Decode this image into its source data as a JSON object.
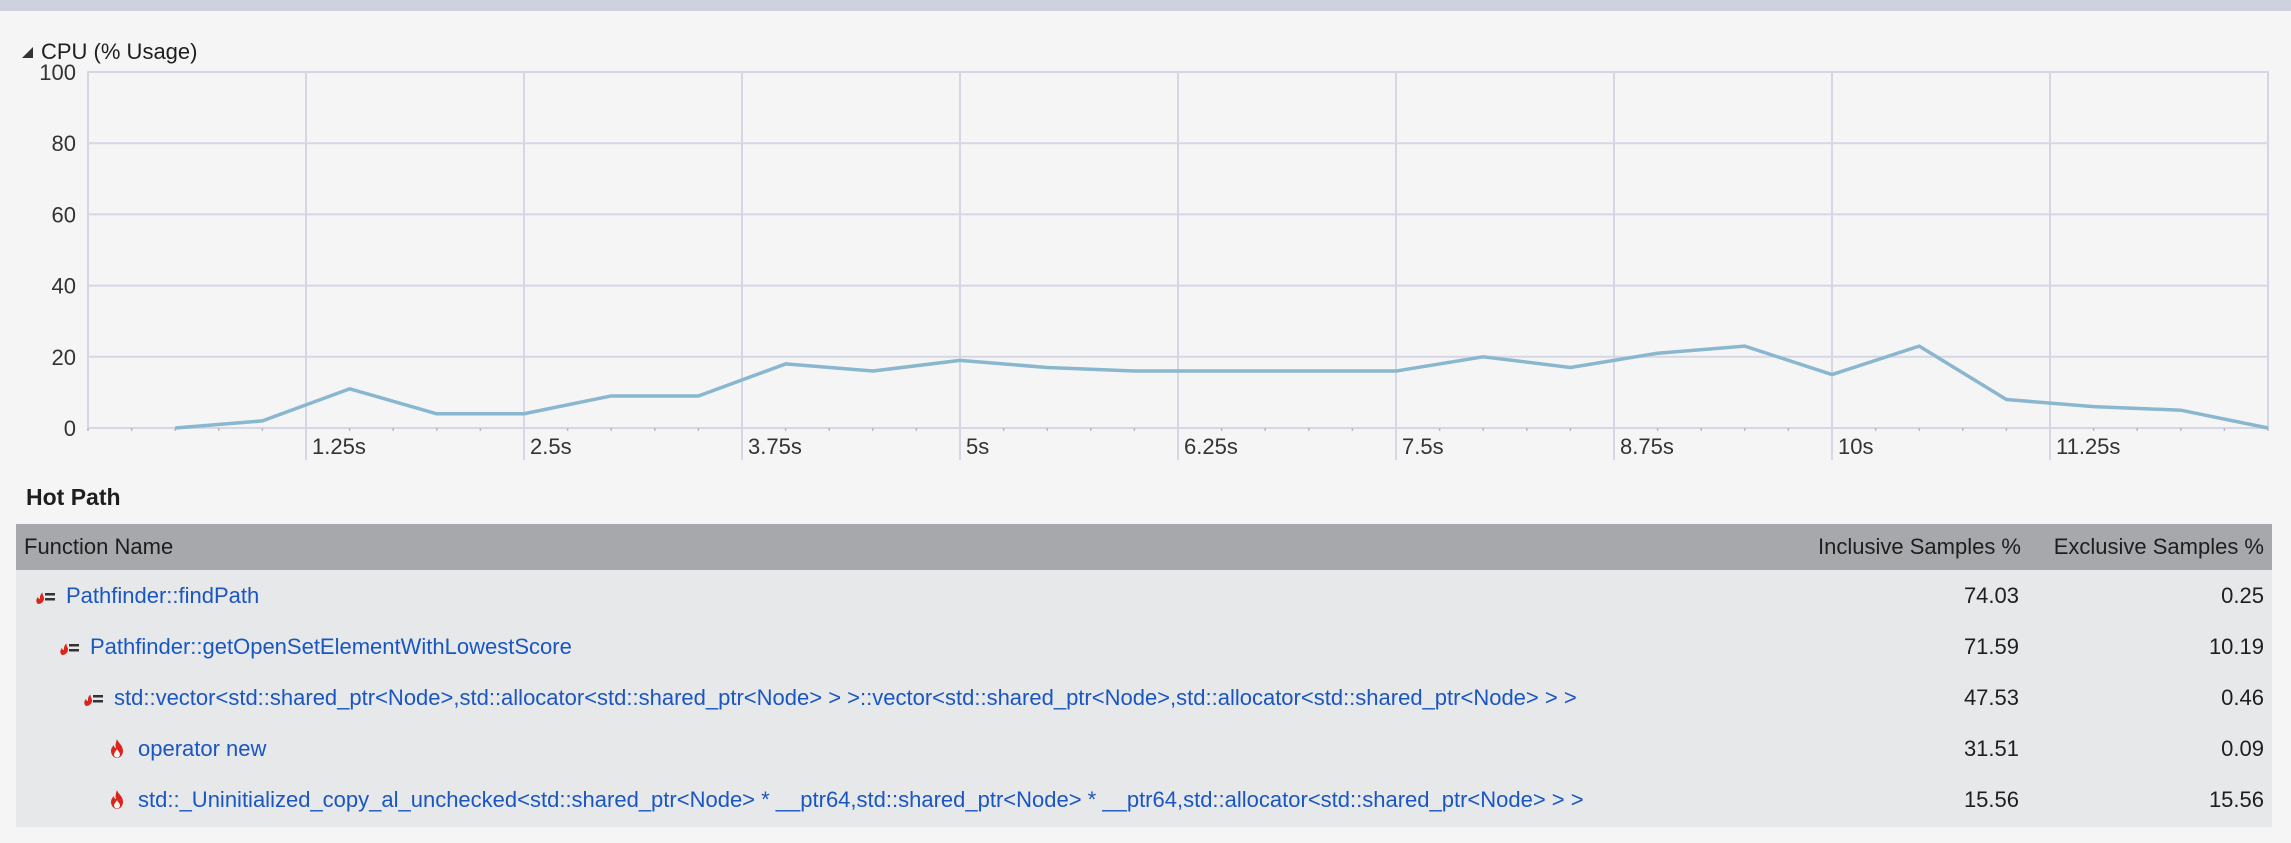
{
  "cpu_section": {
    "title": "CPU (% Usage)"
  },
  "chart_data": {
    "type": "line",
    "title": "CPU (% Usage)",
    "xlabel": "",
    "ylabel": "",
    "ylim": [
      0,
      100
    ],
    "xlim": [
      0,
      12.5
    ],
    "y_ticks": [
      "100",
      "80",
      "60",
      "40",
      "20",
      "0"
    ],
    "y_tick_values": [
      100,
      80,
      60,
      40,
      20,
      0
    ],
    "x_tick_labels": [
      "1.25s",
      "2.5s",
      "3.75s",
      "5s",
      "6.25s",
      "7.5s",
      "8.75s",
      "10s",
      "11.25s"
    ],
    "x_tick_values": [
      1.25,
      2.5,
      3.75,
      5,
      6.25,
      7.5,
      8.75,
      10,
      11.25
    ],
    "grid": true,
    "series": [
      {
        "color": "#8ab7d0",
        "x": [
          0.5,
          1.0,
          1.5,
          2.0,
          2.5,
          3.0,
          3.5,
          4.0,
          4.5,
          5.0,
          5.5,
          6.0,
          6.5,
          7.0,
          7.5,
          8.0,
          8.5,
          9.0,
          9.5,
          10.0,
          10.5,
          11.0,
          11.5,
          12.0,
          12.5
        ],
        "values": [
          0,
          2,
          11,
          4,
          4,
          9,
          9,
          18,
          16,
          19,
          17,
          16,
          16,
          16,
          16,
          20,
          17,
          21,
          23,
          15,
          23,
          8,
          6,
          5,
          0
        ]
      }
    ]
  },
  "hot_path": {
    "title": "Hot Path",
    "columns": {
      "function_name": "Function Name",
      "inclusive": "Inclusive Samples %",
      "exclusive": "Exclusive Samples %"
    },
    "rows": [
      {
        "name": "Pathfinder::findPath",
        "inclusive": "74.03",
        "exclusive": "0.25",
        "icon": "hot-path-icon",
        "indent": 0
      },
      {
        "name": "Pathfinder::getOpenSetElementWithLowestScore",
        "inclusive": "71.59",
        "exclusive": "10.19",
        "icon": "hot-path-icon",
        "indent": 1
      },
      {
        "name": "std::vector<std::shared_ptr<Node>,std::allocator<std::shared_ptr<Node> > >::vector<std::shared_ptr<Node>,std::allocator<std::shared_ptr<Node> > >",
        "inclusive": "47.53",
        "exclusive": "0.46",
        "icon": "hot-path-icon",
        "indent": 2
      },
      {
        "name": "operator new",
        "inclusive": "31.51",
        "exclusive": "0.09",
        "icon": "flame-icon",
        "indent": 3
      },
      {
        "name": "std::_Uninitialized_copy_al_unchecked<std::shared_ptr<Node> * __ptr64,std::shared_ptr<Node> * __ptr64,std::allocator<std::shared_ptr<Node> > >",
        "inclusive": "15.56",
        "exclusive": "15.56",
        "icon": "flame-icon",
        "indent": 3
      }
    ]
  },
  "colors": {
    "flame": "#d9261c",
    "link": "#1a56c2",
    "header_bg": "#a7a8ab",
    "table_bg": "#e7e8ea"
  }
}
